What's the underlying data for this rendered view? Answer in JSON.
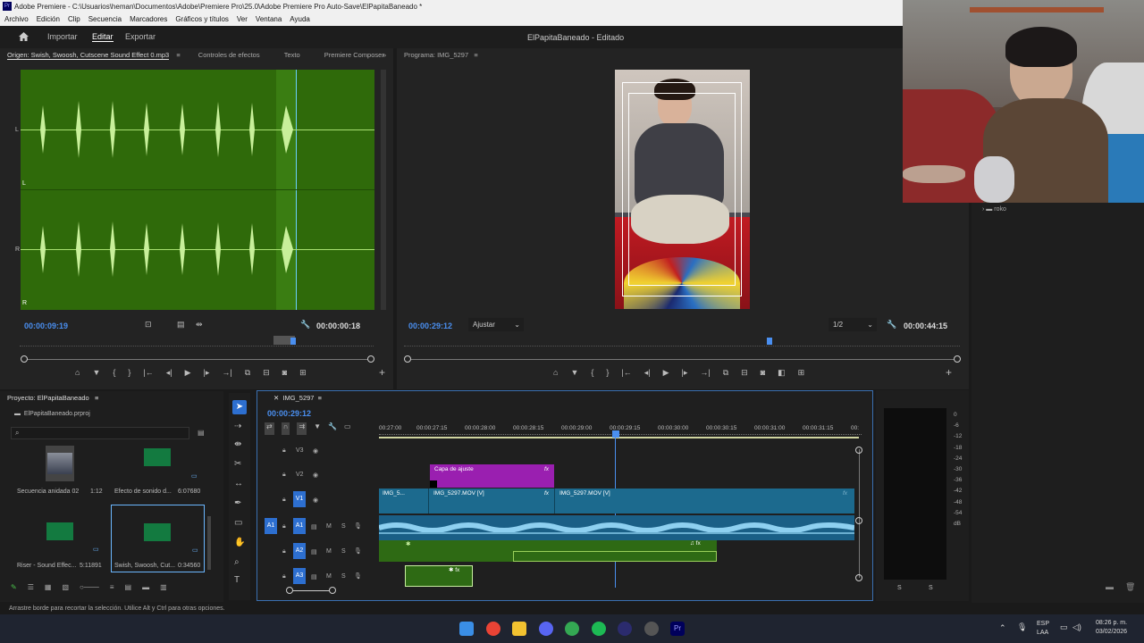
{
  "titlebar": {
    "text": "Adobe Premiere - C:\\Usuarios\\heman\\Documentos\\Adobe\\Premiere Pro\\25.0\\Adobe Premiere Pro Auto-Save\\ElPapitaBaneado *"
  },
  "menu": [
    "Archivo",
    "Edición",
    "Clip",
    "Secuencia",
    "Marcadores",
    "Gráficos y títulos",
    "Ver",
    "Ventana",
    "Ayuda"
  ],
  "workspace": {
    "import": "Importar",
    "edit": "Editar",
    "export": "Exportar",
    "project_title": "ElPapitaBaneado - Editado"
  },
  "source": {
    "tabs": [
      "Origen: Swish, Swoosh, Cutscene Sound Effect 0.mp3",
      "Controles de efectos",
      "Texto",
      "Premiere Composer"
    ],
    "channel_labels": [
      "L",
      "L",
      "R",
      "R"
    ],
    "timecode_left": "00:00:09:19",
    "timecode_right": "00:00:00:18"
  },
  "program": {
    "tab": "Programa: IMG_5297",
    "timecode_left": "00:00:29:12",
    "fit": "Ajustar",
    "resolution": "1/2",
    "timecode_right": "00:00:44:15"
  },
  "project": {
    "title": "Proyecto: ElPapitaBaneado",
    "file": "ElPapitaBaneado.prproj",
    "items": [
      {
        "name": "Secuencia anidada 02",
        "dur": "1:12"
      },
      {
        "name": "Efecto de sonido d...",
        "dur": "6:07680"
      },
      {
        "name": "Riser - Sound Effec...",
        "dur": "5:11891"
      },
      {
        "name": "Swish, Swoosh, Cut...",
        "dur": "0:34560"
      }
    ]
  },
  "timeline": {
    "tab": "IMG_5297",
    "timecode": "00:00:29:12",
    "ruler": [
      "00:27:00",
      "00:00:27:15",
      "00:00:28:00",
      "00:00:28:15",
      "00:00:29:00",
      "00:00:29:15",
      "00:00:30:00",
      "00:00:30:15",
      "00:00:31:00",
      "00:00:31:15",
      "00:"
    ],
    "tracks_video": [
      "V3",
      "V2",
      "V1"
    ],
    "tracks_audio": [
      "A1",
      "A2",
      "A3"
    ],
    "clips": {
      "adjust": "Capa de ajuste",
      "v1a": "IMG_5...",
      "v1b": "IMG_5297.MOV [V]",
      "v1c": "IMG_5297.MOV [V]"
    },
    "source_patch_a1": "A1",
    "source_patch_v1": "V1"
  },
  "meter": {
    "db": [
      "0",
      "-6",
      "-12",
      "-18",
      "-24",
      "-30",
      "-36",
      "-42",
      "-48",
      "-54",
      "dB"
    ],
    "s1": "S",
    "s2": "S"
  },
  "webcam_panel": {
    "folder": "roko"
  },
  "status": "Arrastre borde para recortar la selección. Utilice Alt y Ctrl para otras opciones.",
  "taskbar": {
    "lang": "ESP",
    "layout": "LAA",
    "time": "08:26 p. m.",
    "date": "03/02/2026"
  }
}
